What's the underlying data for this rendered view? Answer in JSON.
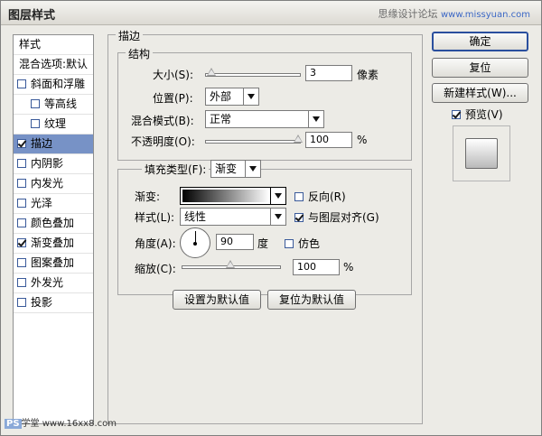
{
  "window": {
    "title": "图层样式",
    "watermark": "思缘设计论坛",
    "watermark_url": "www.missyuan.com"
  },
  "sidebar": {
    "items": [
      {
        "label": "样式",
        "type": "header",
        "selected": false
      },
      {
        "label": "混合选项:默认",
        "type": "header",
        "selected": false
      },
      {
        "label": "斜面和浮雕",
        "type": "check",
        "checked": false,
        "selected": false
      },
      {
        "label": "等高线",
        "type": "subcheck",
        "checked": false,
        "selected": false
      },
      {
        "label": "纹理",
        "type": "subcheck",
        "checked": false,
        "selected": false
      },
      {
        "label": "描边",
        "type": "check",
        "checked": true,
        "selected": true
      },
      {
        "label": "内阴影",
        "type": "check",
        "checked": false,
        "selected": false
      },
      {
        "label": "内发光",
        "type": "check",
        "checked": false,
        "selected": false
      },
      {
        "label": "光泽",
        "type": "check",
        "checked": false,
        "selected": false
      },
      {
        "label": "颜色叠加",
        "type": "check",
        "checked": false,
        "selected": false
      },
      {
        "label": "渐变叠加",
        "type": "check",
        "checked": true,
        "selected": false
      },
      {
        "label": "图案叠加",
        "type": "check",
        "checked": false,
        "selected": false
      },
      {
        "label": "外发光",
        "type": "check",
        "checked": false,
        "selected": false
      },
      {
        "label": "投影",
        "type": "check",
        "checked": false,
        "selected": false
      }
    ]
  },
  "stroke": {
    "title": "描边",
    "structure_title": "结构",
    "size_label": "大小(S):",
    "size_value": "3",
    "size_unit": "像素",
    "position_label": "位置(P):",
    "position_value": "外部",
    "blend_label": "混合模式(B):",
    "blend_value": "正常",
    "opacity_label": "不透明度(O):",
    "opacity_value": "100",
    "opacity_unit": "%",
    "size_level": 0.06,
    "opacity_level": 1.0
  },
  "fill": {
    "type_label": "填充类型(F):",
    "type_value": "渐变",
    "gradient_label": "渐变:",
    "reverse_label": "反向(R)",
    "reverse_checked": false,
    "style_label": "样式(L):",
    "style_value": "线性",
    "align_label": "与图层对齐(G)",
    "align_checked": true,
    "angle_label": "角度(A):",
    "angle_value": "90",
    "angle_unit": "度",
    "dither_label": "仿色",
    "dither_checked": false,
    "scale_label": "缩放(C):",
    "scale_value": "100",
    "scale_unit": "%",
    "scale_level": 0.5
  },
  "buttons": {
    "set_default": "设置为默认值",
    "reset_default": "复位为默认值",
    "ok": "确定",
    "reset": "复位",
    "new_style": "新建样式(W)...",
    "preview_label": "预览(V)",
    "preview_checked": true
  },
  "corner_watermark": {
    "badge": "PS",
    "text": "学堂",
    "url": "www.16xx8.com"
  },
  "colors": {
    "selection": "#7792c6",
    "default_button_border": "#2a4f9e"
  }
}
